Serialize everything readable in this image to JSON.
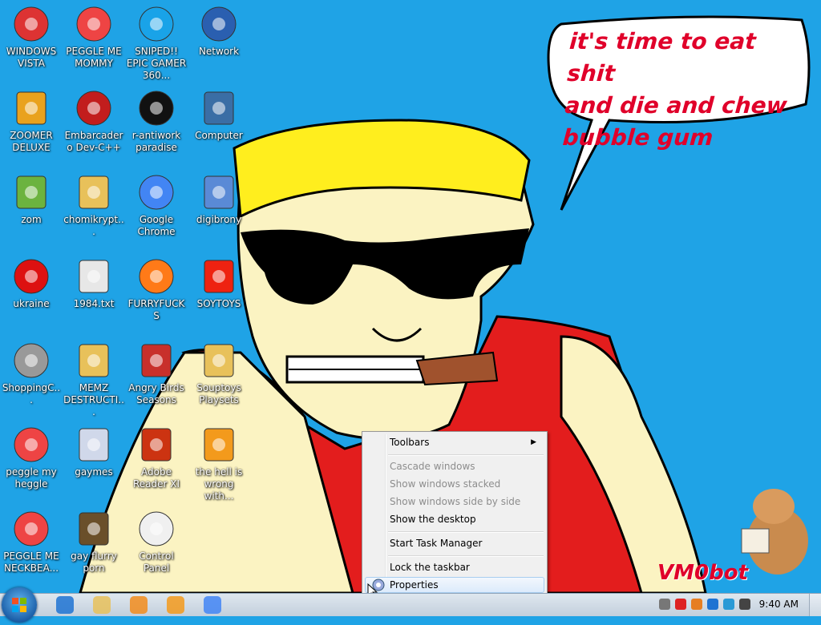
{
  "desktop": {
    "icons": [
      {
        "label": "WINDOWS VISTA",
        "icon": "gas-grill-icon"
      },
      {
        "label": "PEGGLE ME MOMMY",
        "icon": "peggle-icon"
      },
      {
        "label": "SNIPED!! EPIC GAMER 360...",
        "icon": "skype-icon"
      },
      {
        "label": "Network",
        "icon": "network-icon"
      },
      {
        "label": "ZOOMER DELUXE",
        "icon": "zuma-icon"
      },
      {
        "label": "Embarcadero Dev-C++",
        "icon": "devcpp-icon"
      },
      {
        "label": "r-antiwork paradise",
        "icon": "antiwork-icon"
      },
      {
        "label": "Computer",
        "icon": "computer-icon"
      },
      {
        "label": "zom",
        "icon": "plant-icon"
      },
      {
        "label": "chomikrypt...",
        "icon": "shortcut-app-icon"
      },
      {
        "label": "Google Chrome",
        "icon": "chrome-icon"
      },
      {
        "label": "digibrony",
        "icon": "digi-icon"
      },
      {
        "label": "ukraine",
        "icon": "radiation-icon"
      },
      {
        "label": "1984.txt",
        "icon": "text-file-icon"
      },
      {
        "label": "FURRYFUCKS",
        "icon": "firefox-icon"
      },
      {
        "label": "SOYTOYS",
        "icon": "soytoys-icon"
      },
      {
        "label": "ShoppingC...",
        "icon": "flash-icon"
      },
      {
        "label": "MEMZ DESTRUCTI...",
        "icon": "shortcut-app-icon"
      },
      {
        "label": "Angry Birds Seasons",
        "icon": "angry-birds-icon"
      },
      {
        "label": "Souptoys Playsets",
        "icon": "shortcut-app-icon"
      },
      {
        "label": "peggle my heggle",
        "icon": "peggle-icon"
      },
      {
        "label": "gaymes",
        "icon": "games-folder-icon"
      },
      {
        "label": "Adobe Reader XI",
        "icon": "adobe-reader-icon"
      },
      {
        "label": "the hell is wrong with...",
        "icon": "uc-browser-icon"
      },
      {
        "label": "PEGGLE ME NECKBEA...",
        "icon": "peggle-icon"
      },
      {
        "label": "gay flurry porn",
        "icon": "box-icon"
      },
      {
        "label": "Control Panel",
        "icon": "control-panel-icon"
      }
    ]
  },
  "wallpaper": {
    "speech": [
      "it's time to eat shit",
      "and die and chew",
      "bubble gum"
    ],
    "watermark": "VM0bot"
  },
  "context_menu": {
    "items": [
      {
        "label": "Toolbars",
        "enabled": true,
        "submenu": true
      },
      {
        "label": "Cascade windows",
        "enabled": false
      },
      {
        "label": "Show windows stacked",
        "enabled": false
      },
      {
        "label": "Show windows side by side",
        "enabled": false
      },
      {
        "label": "Show the desktop",
        "enabled": true
      },
      {
        "label": "Start Task Manager",
        "enabled": true
      },
      {
        "label": "Lock the taskbar",
        "enabled": true
      },
      {
        "label": "Properties",
        "enabled": true,
        "highlighted": true
      }
    ]
  },
  "taskbar": {
    "pinned": [
      "internet-explorer-icon",
      "explorer-folder-icon",
      "media-player-icon",
      "uc-browser-icon",
      "chrome-icon"
    ],
    "tray_icons": [
      "app-tray-icon",
      "vivaldi-icon",
      "search-tray-icon",
      "shield-icon",
      "monitor-icon",
      "volume-icon"
    ],
    "clock": "9:40 AM"
  },
  "colors": {
    "desktop_bg": "#1fa3e6",
    "speech_text": "#e0002a"
  }
}
